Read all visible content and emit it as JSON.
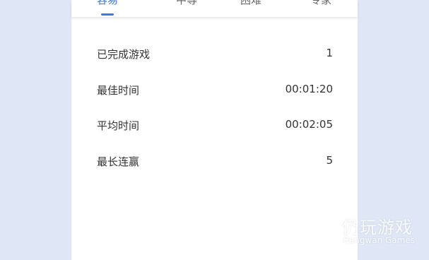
{
  "tabs": [
    {
      "label": "容易",
      "active": true
    },
    {
      "label": "中等",
      "active": false
    },
    {
      "label": "困难",
      "active": false
    },
    {
      "label": "专家",
      "active": false
    }
  ],
  "stats": [
    {
      "label": "已完成游戏",
      "value": "1"
    },
    {
      "label": "最佳时间",
      "value": "00:01:20"
    },
    {
      "label": "平均时间",
      "value": "00:02:05"
    },
    {
      "label": "最长连赢",
      "value": "5"
    }
  ],
  "watermark": {
    "name": "仍玩游戏",
    "subtitle": "Rengwan Games"
  },
  "colors": {
    "accent": "#3d7ae0",
    "background": "#dfe6f5",
    "panel": "#ffffff",
    "text": "#333333"
  }
}
